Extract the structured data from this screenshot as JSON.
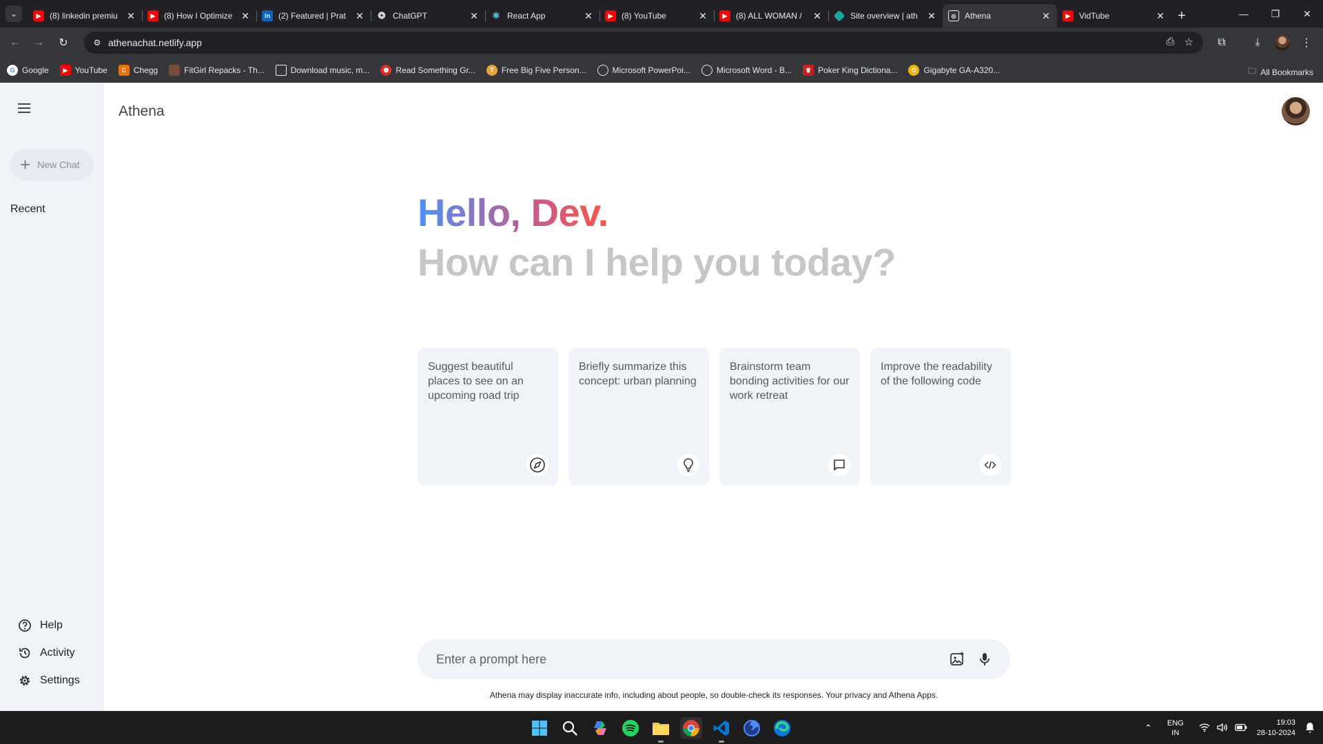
{
  "browser": {
    "tabs": [
      {
        "title": "(8) linkedin premiu",
        "favicon": "youtube-icon",
        "color": "#ff0000",
        "active": false
      },
      {
        "title": "(8) How I Optimize",
        "favicon": "youtube-icon",
        "color": "#ff0000",
        "active": false
      },
      {
        "title": "(2) Featured | Prat",
        "favicon": "linkedin-icon",
        "color": "#0a66c2",
        "active": false
      },
      {
        "title": "ChatGPT",
        "favicon": "chatgpt-icon",
        "color": "#202124",
        "active": false
      },
      {
        "title": "React App",
        "favicon": "react-icon",
        "color": "#202124",
        "active": false
      },
      {
        "title": "(8) YouTube",
        "favicon": "youtube-icon",
        "color": "#ff0000",
        "active": false
      },
      {
        "title": "(8) ALL WOMAN /",
        "favicon": "youtube-icon",
        "color": "#ff0000",
        "active": false
      },
      {
        "title": "Site overview | ath",
        "favicon": "netlify-icon",
        "color": "#1ea59a",
        "active": false
      },
      {
        "title": "Athena",
        "favicon": "athena-icon",
        "color": "#e8eaed",
        "active": true
      },
      {
        "title": "VidTube",
        "favicon": "youtube-icon",
        "color": "#ff0000",
        "active": false
      }
    ],
    "url": "athenachat.netlify.app",
    "bookmarks": [
      {
        "label": "Google",
        "icon": "google-icon",
        "color": "#ffffff"
      },
      {
        "label": "YouTube",
        "icon": "youtube-icon",
        "color": "#ff0000"
      },
      {
        "label": "Chegg",
        "icon": "chegg-icon",
        "color": "#eb7100"
      },
      {
        "label": "FitGirl Repacks - Th...",
        "icon": "fitgirl-icon",
        "color": "#7a4a3a"
      },
      {
        "label": "Download music, m...",
        "icon": "music-icon",
        "color": "#5f6368"
      },
      {
        "label": "Read Something Gr...",
        "icon": "book-icon",
        "color": "#d93025"
      },
      {
        "label": "Free Big Five Person...",
        "icon": "test-icon",
        "color": "#e8a33d"
      },
      {
        "label": "Microsoft PowerPoi...",
        "icon": "globe-icon",
        "color": "#5f6368"
      },
      {
        "label": "Microsoft Word - B...",
        "icon": "globe-icon",
        "color": "#5f6368"
      },
      {
        "label": "Poker King Dictiona...",
        "icon": "crown-icon",
        "color": "#c5221f"
      },
      {
        "label": "Gigabyte GA-A320...",
        "icon": "gigabyte-icon",
        "color": "#f4b400"
      }
    ],
    "all_bookmarks": "All Bookmarks"
  },
  "app": {
    "title": "Athena",
    "new_chat": "New Chat",
    "recent": "Recent",
    "bottom_nav": [
      {
        "label": "Help",
        "icon": "help-icon"
      },
      {
        "label": "Activity",
        "icon": "history-icon"
      },
      {
        "label": "Settings",
        "icon": "settings-icon"
      }
    ],
    "greeting": "Hello, Dev.",
    "subtitle": "How can I help you today?",
    "cards": [
      {
        "text": "Suggest beautiful places to see on an upcoming road trip",
        "icon": "compass-icon"
      },
      {
        "text": "Briefly summarize this concept: urban planning",
        "icon": "bulb-icon"
      },
      {
        "text": "Brainstorm team bonding activities for our work retreat",
        "icon": "message-icon"
      },
      {
        "text": "Improve the readability of the following code",
        "icon": "code-icon"
      }
    ],
    "prompt_placeholder": "Enter a prompt here",
    "disclaimer": "Athena may display inaccurate info, including about people, so double-check its responses. Your privacy and Athena Apps."
  },
  "taskbar": {
    "language": "ENG",
    "region": "IN",
    "time": "19:03",
    "date": "28-10-2024"
  }
}
